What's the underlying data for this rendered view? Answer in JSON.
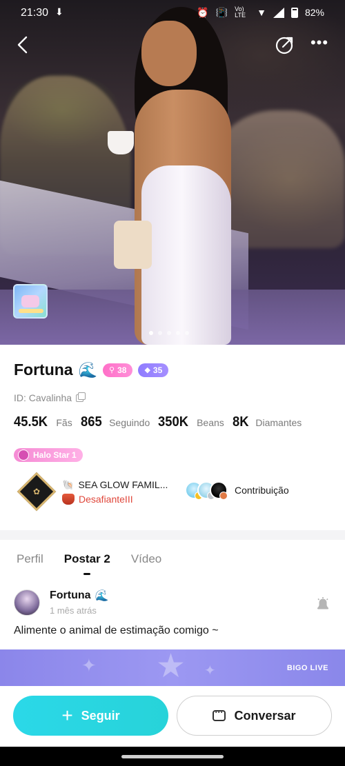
{
  "status_bar": {
    "time": "21:30",
    "signal_label": "Vo) LTE",
    "battery": "82%"
  },
  "profile": {
    "name": "Fortuna",
    "name_emoji": "🌊",
    "badge_level": "38",
    "badge_gem": "35",
    "id_text": "ID: Cavalinha",
    "stats": [
      {
        "value": "45.5K",
        "label": "Fãs"
      },
      {
        "value": "865",
        "label": "Seguindo"
      },
      {
        "value": "350K",
        "label": "Beans"
      },
      {
        "value": "8K",
        "label": "Diamantes"
      }
    ],
    "halo_label": "Halo Star 1",
    "family": {
      "name": "SEA GLOW FAMIL...",
      "rank": "DesafianteIII"
    },
    "contribution_label": "Contribuição"
  },
  "photo_carousel": {
    "pages": 5,
    "active_page": 1
  },
  "tabs": [
    {
      "label": "Perfil",
      "active": false
    },
    {
      "label": "Postar 2",
      "active": true
    },
    {
      "label": "Vídeo",
      "active": false
    }
  ],
  "post": {
    "author": "Fortuna",
    "author_emoji": "🌊",
    "time": "1 mês atrás",
    "text": "Alimente o animal de estimação comigo ~",
    "banner_text": "BIGO LIVE"
  },
  "actions": {
    "follow_label": "Seguir",
    "chat_label": "Conversar"
  },
  "colors": {
    "accent": "#27d3d9",
    "badge_pink": "#ff6fc8",
    "badge_purple": "#8f7cff",
    "rank_red": "#e0473b"
  },
  "icons": [
    "back-arrow-icon",
    "share-icon",
    "more-icon",
    "copy-icon",
    "halo-star-icon",
    "shell-icon",
    "crest-icon",
    "alarm-icon",
    "plus-icon",
    "chat-icon"
  ]
}
